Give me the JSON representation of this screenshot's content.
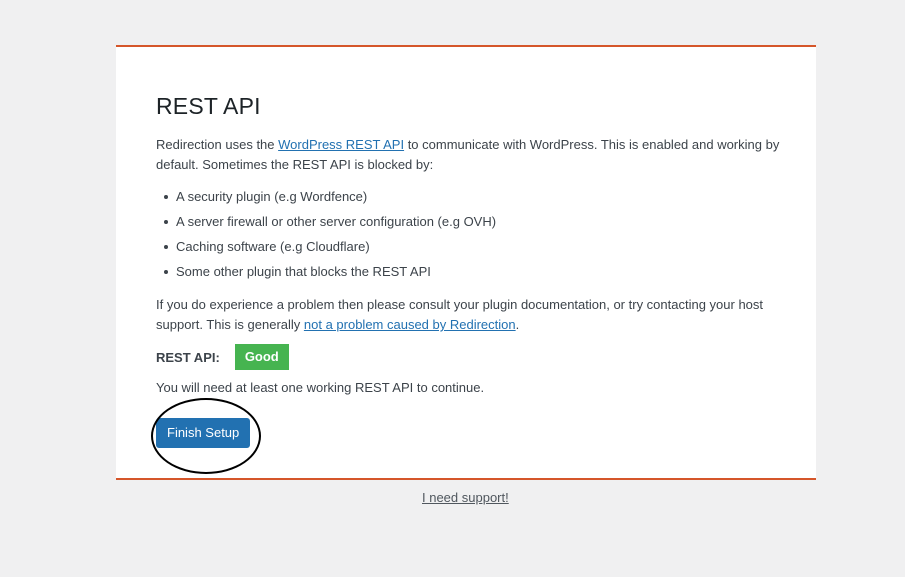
{
  "page": {
    "title": "REST API",
    "intro_before": "Redirection uses the ",
    "intro_link": "WordPress REST API",
    "intro_after": " to communicate with WordPress. This is enabled and working by default. Sometimes the REST API is blocked by:",
    "reasons": [
      "A security plugin (e.g Wordfence)",
      "A server firewall or other server configuration (e.g OVH)",
      "Caching software (e.g Cloudflare)",
      "Some other plugin that blocks the REST API"
    ],
    "consult_before": "If you do experience a problem then please consult your plugin documentation, or try contacting your host support. This is generally ",
    "consult_link": "not a problem caused by Redirection",
    "consult_after": ".",
    "status_label": "REST API:",
    "status_value": "Good",
    "requirement_text": "You will need at least one working REST API to continue.",
    "finish_button": "Finish Setup",
    "support_link": "I need support!"
  },
  "colors": {
    "accent_border": "#d5562a",
    "primary_button": "#2271b1",
    "status_good": "#46b450",
    "link": "#2271b1"
  }
}
